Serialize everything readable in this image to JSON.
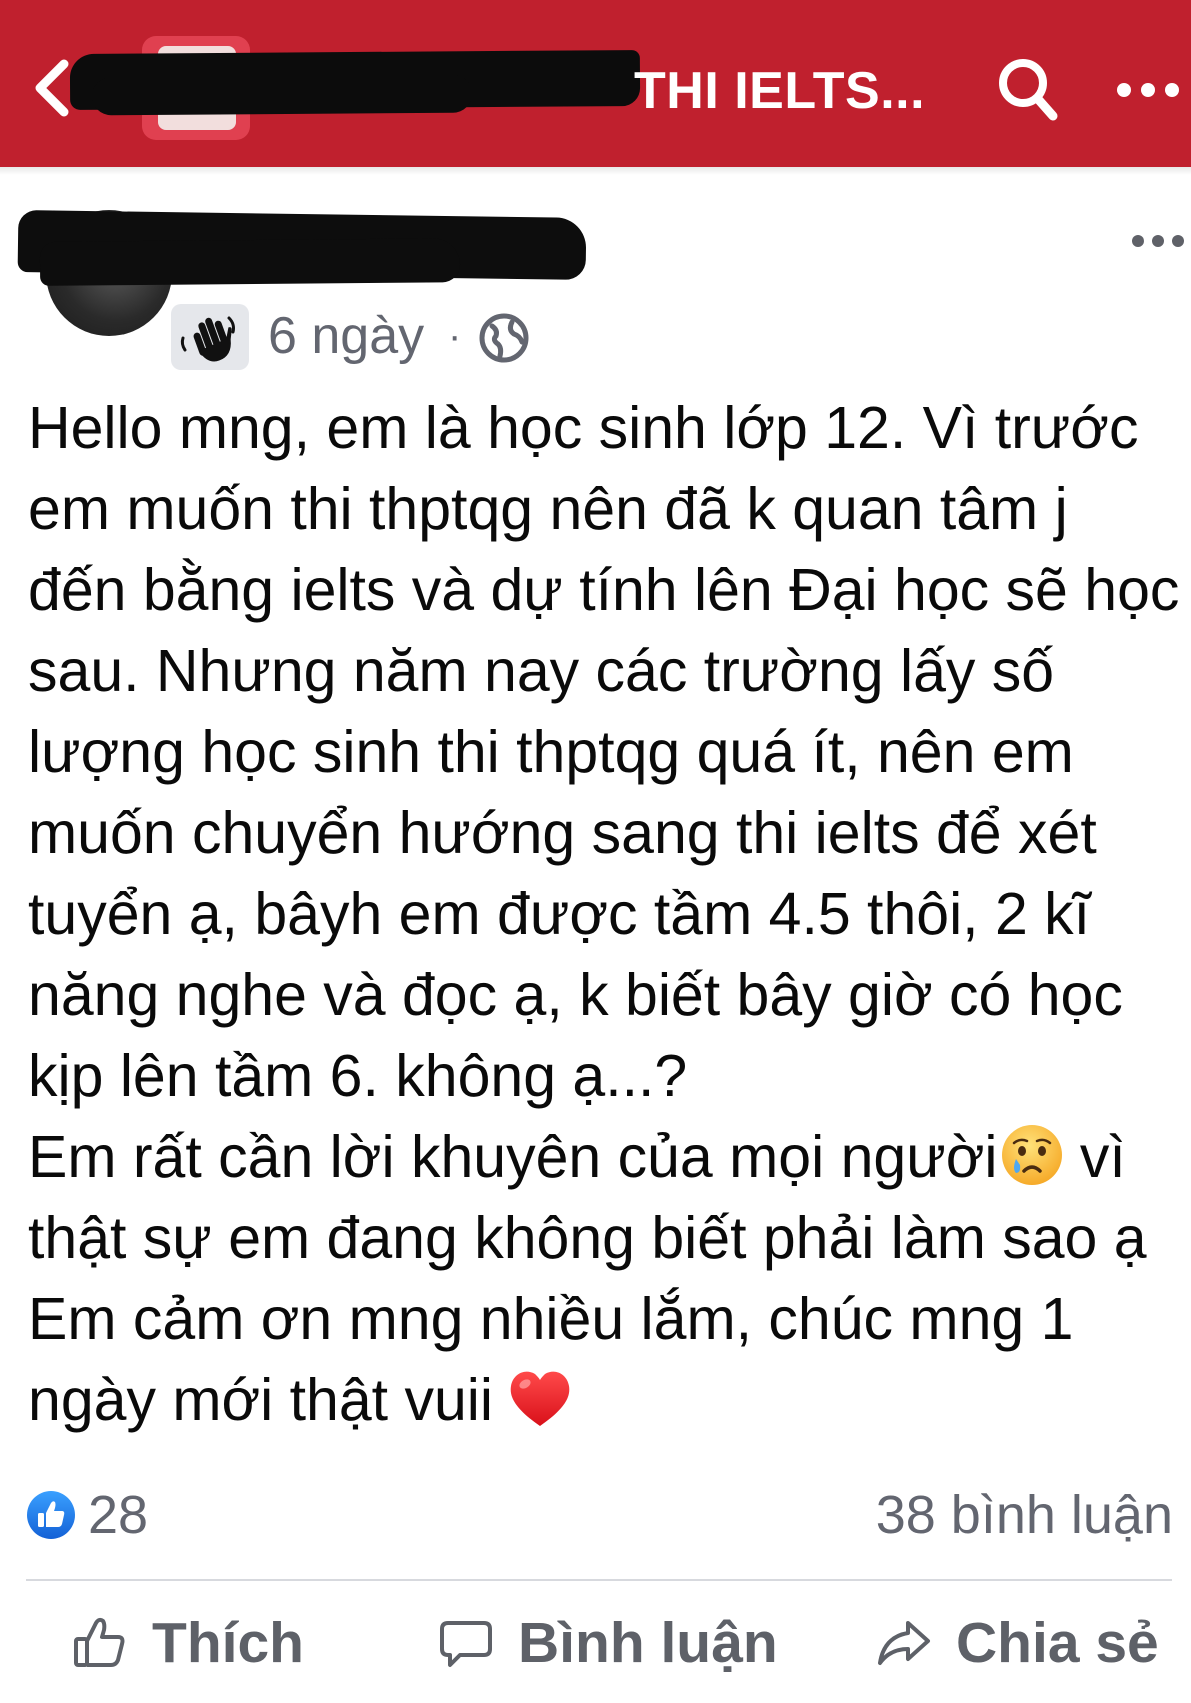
{
  "header": {
    "title": "THI IELTS...",
    "back_icon": "chevron-left-icon",
    "search_icon": "search-icon",
    "more_icon": "more-horizontal-icon",
    "bar_color": "#c0202e"
  },
  "post": {
    "time": "6 ngày",
    "separator": "·",
    "privacy_icon": "globe-icon",
    "badge_icon": "wave-hand-icon",
    "lines": [
      "Hello mng, em là học sinh lớp 12. Vì trước",
      "em muốn thi thptqg nên đã k quan tâm j",
      "đến bằng ielts và dự tính lên Đại học sẽ học",
      "sau. Nhưng năm nay các trường lấy số",
      "lượng học sinh thi thptqg quá ít, nên em",
      "muốn chuyển hướng sang thi ielts để xét",
      "tuyển ạ, bâyh em được tầm 4.5 thôi, 2 kĩ",
      "năng nghe và đọc ạ, k biết bây giờ có học",
      "kịp lên tầm 6. không ạ...?",
      "Em rất cần lời khuyên của mọi người",
      "vì",
      "thật sự em đang không biết phải làm sao ạ",
      "Em cảm ơn mng nhiều lắm, chúc mng 1",
      "ngày mới thật vuii"
    ]
  },
  "reactions": {
    "like_count": "28",
    "comments": "38 bình luận"
  },
  "actions": {
    "like": "Thích",
    "comment": "Bình luận",
    "share": "Chia sẻ"
  }
}
